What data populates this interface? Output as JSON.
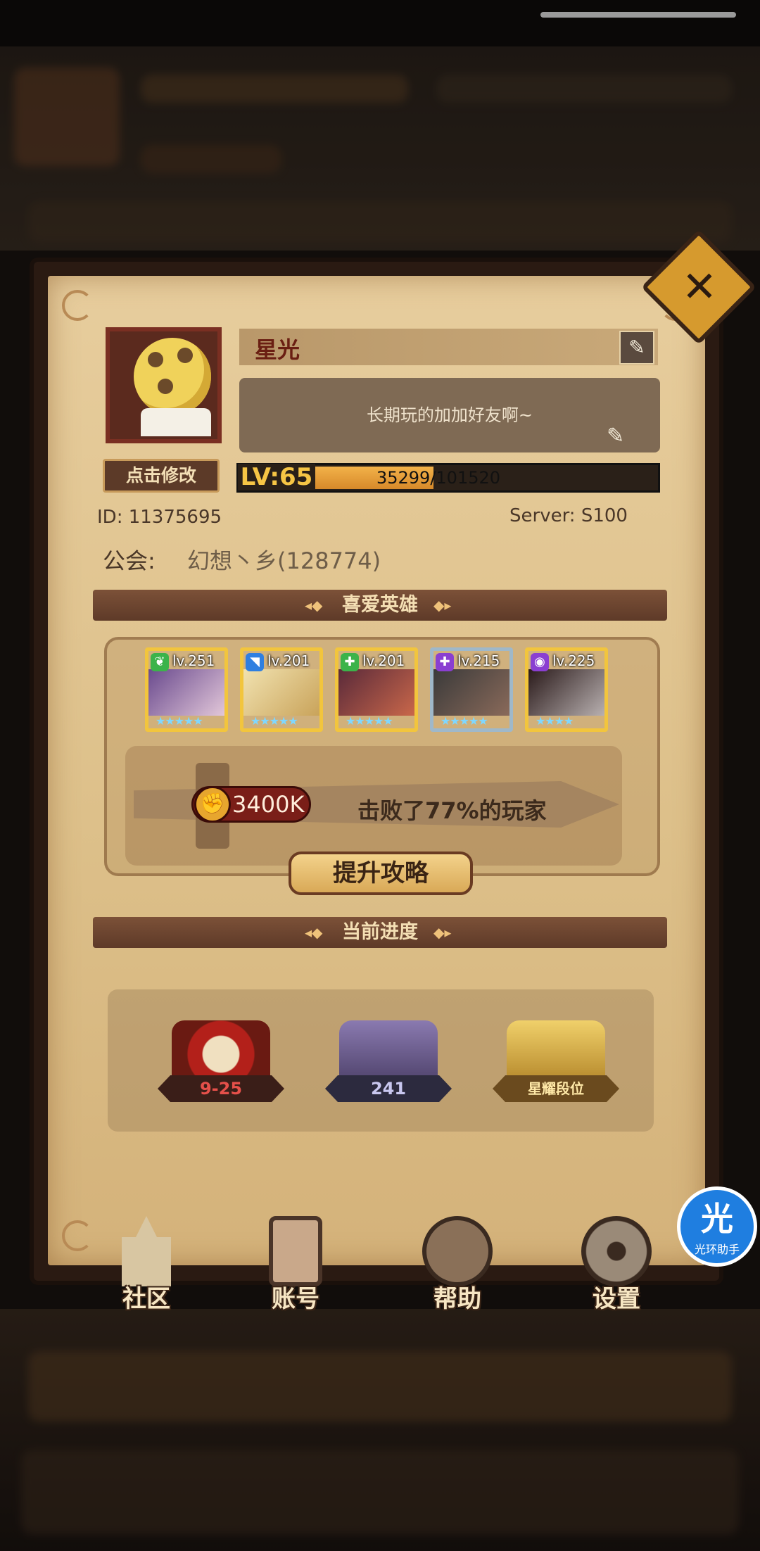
{
  "profile": {
    "name": "星光",
    "signature": "长期玩的加加好友啊~",
    "edit_avatar_label": "点击修改",
    "level_label": "LV:65",
    "exp_text": "35299/101520",
    "exp_progress": 0.348,
    "id_label": "ID: 11375695",
    "server_label": "Server: S100",
    "guild_label": "公会:",
    "guild_value": "幻想丶乡(128774)"
  },
  "favorite_heroes": {
    "title": "喜爱英雄",
    "heroes": [
      {
        "level": "lv.251",
        "stars": "★★★★★",
        "element_icon": "leaf-icon",
        "element_color": "#3bb34a",
        "frame_color": "#f2c53d"
      },
      {
        "level": "lv.201",
        "stars": "★★★★★",
        "element_icon": "water-icon",
        "element_color": "#2f7fe0",
        "frame_color": "#f2c53d"
      },
      {
        "level": "lv.201",
        "stars": "★★★★★",
        "element_icon": "plus-icon",
        "element_color": "#3bb34a",
        "frame_color": "#f2c53d"
      },
      {
        "level": "lv.215",
        "stars": "★★★★★",
        "element_icon": "plus-icon",
        "element_color": "#8a3fd1",
        "frame_color": "#9fb8c9"
      },
      {
        "level": "lv.225",
        "stars": "★★★★",
        "element_icon": "dark-icon",
        "element_color": "#8a3fd1",
        "frame_color": "#f2c53d"
      }
    ],
    "power_value": "3400K",
    "beat_text": "击败了77%的玩家",
    "guide_button": "提升攻略"
  },
  "progress": {
    "title": "当前进度",
    "badges": [
      {
        "label": "9-25",
        "icon": "campaign-book-icon",
        "color": "#b3201a",
        "ribbon": "#3a1e18",
        "text_color": "#e6504a"
      },
      {
        "label": "241",
        "icon": "tower-sword-icon",
        "color": "#6a5a8e",
        "ribbon": "#2c2a3e",
        "text_color": "#c9c7ef"
      },
      {
        "label": "星耀段位",
        "icon": "arena-crossed-swords-icon",
        "color": "#d6a93a",
        "ribbon": "#6a4a1e",
        "text_color": "#ffe9a8"
      }
    ]
  },
  "nav": {
    "community": "社区",
    "account": "账号",
    "help": "帮助",
    "settings": "设置"
  },
  "assistant": {
    "glyph": "光",
    "label": "光环助手"
  },
  "colors": {
    "panel_bg": "#e7cd9d",
    "section_header": "#6a442f",
    "exp_fill": "#f2b24a",
    "level_text": "#f6c545"
  }
}
